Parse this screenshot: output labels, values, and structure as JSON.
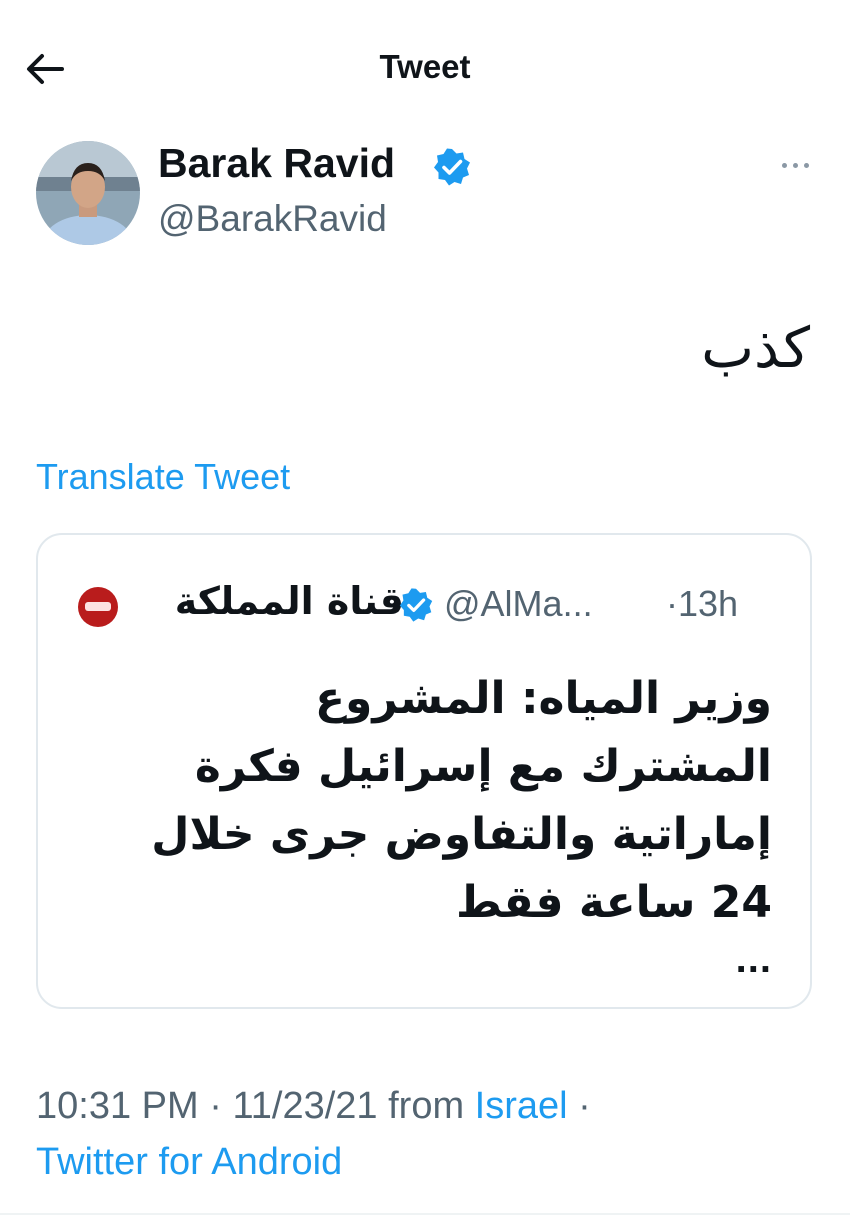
{
  "header": {
    "title": "Tweet",
    "back_icon": "arrow-left-icon"
  },
  "author": {
    "name": "Barak Ravid",
    "handle": "@BarakRavid",
    "verified_icon": "verified-badge-icon",
    "avatar": "avatar"
  },
  "more_icon": "more-horizontal-icon",
  "tweet": {
    "text": "كذب",
    "translate_label": "Translate Tweet"
  },
  "quote": {
    "name": "قناة المملكة",
    "handle": "@AlMa...",
    "time": "·13h",
    "lines": [
      "وزير المياه: المشروع",
      "المشترك مع إسرائيل فكرة",
      "إماراتية والتفاوض جرى خلال",
      "24 ساعة فقط"
    ],
    "ellipsis": "..."
  },
  "meta": {
    "time": "10:31 PM",
    "sep1": " · ",
    "date": "11/23/21",
    "from": " from ",
    "location": "Israel",
    "sep2": " ·",
    "source": "Twitter for Android"
  },
  "colors": {
    "link": "#1d9bf0",
    "secondary_text": "#536471",
    "primary_text": "#0f1419",
    "border": "#e1e8ed"
  }
}
